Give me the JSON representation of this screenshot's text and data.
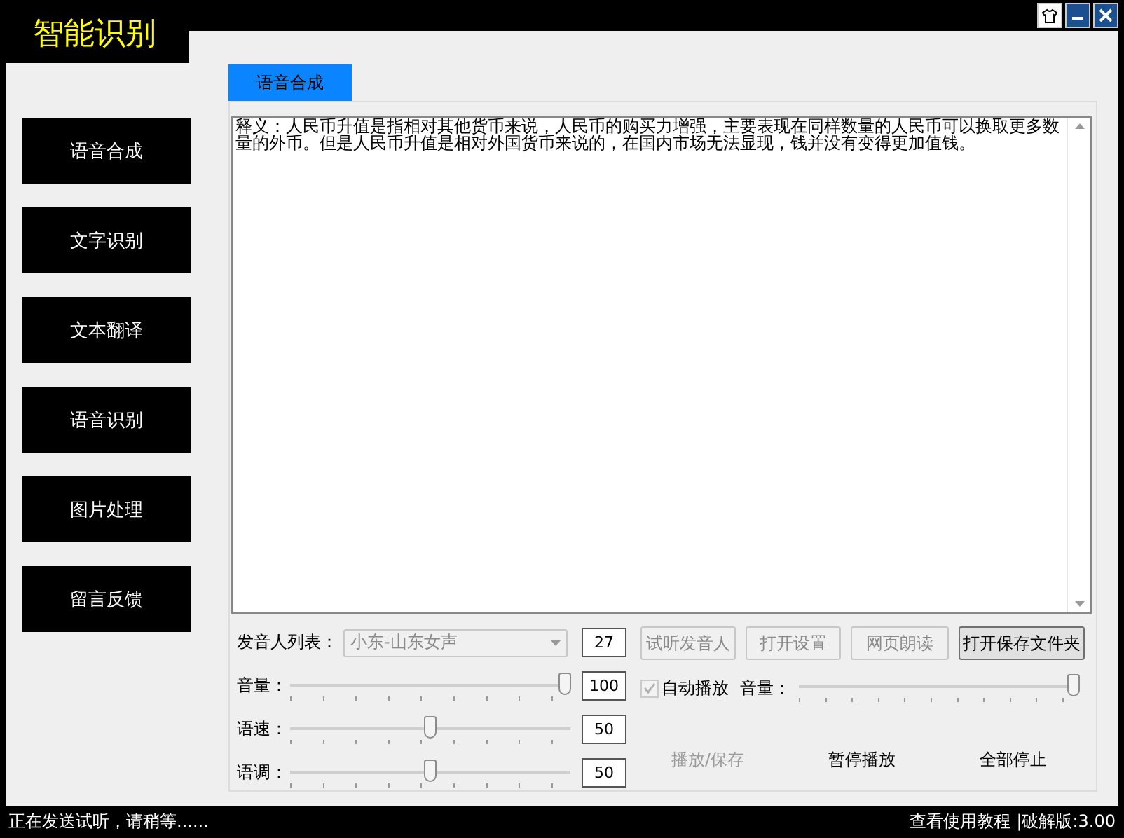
{
  "window": {
    "title": "智能识别"
  },
  "sidebar": {
    "items": [
      {
        "label": "语音合成"
      },
      {
        "label": "文字识别"
      },
      {
        "label": "文本翻译"
      },
      {
        "label": "语音识别"
      },
      {
        "label": "图片处理"
      },
      {
        "label": "留言反馈"
      }
    ]
  },
  "tabs": [
    {
      "label": "语音合成",
      "selected": true
    }
  ],
  "text_area": {
    "value": "释义：人民币升值是指相对其他货币来说，人民币的购买力增强，主要表现在同样数量的人民币可以换取更多数量的外币。但是人民币升值是相对外国货币来说的，在国内市场无法显现，钱并没有变得更加值钱。"
  },
  "voice": {
    "label": "发音人列表：",
    "value": "小东-山东女声",
    "disabled": true,
    "count": "27"
  },
  "sliders": [
    {
      "label": "音量：",
      "level": 1,
      "value": "100"
    },
    {
      "label": "语速：",
      "level": 0.5,
      "value": "50"
    },
    {
      "label": "语调：",
      "level": 0.5,
      "value": "50"
    }
  ],
  "buttons": [
    {
      "label": "试听发音人",
      "disabled": true
    },
    {
      "label": "打开设置",
      "disabled": true
    },
    {
      "label": "网页朗读",
      "disabled": true
    },
    {
      "label": "打开保存文件夹",
      "disabled": false
    }
  ],
  "autoplay": {
    "label": "自动播放",
    "checked": true,
    "disabled": true
  },
  "playback_volume": {
    "label": "音量：",
    "level": 1
  },
  "actions": [
    {
      "label": "播放/保存",
      "disabled": true
    },
    {
      "label": "暂停播放",
      "disabled": false
    },
    {
      "label": "全部停止",
      "disabled": false
    }
  ],
  "status_bar": {
    "message": "正在发送试听，请稍等......",
    "help_link": "查看使用教程",
    "version": "|破解版:3.00"
  }
}
